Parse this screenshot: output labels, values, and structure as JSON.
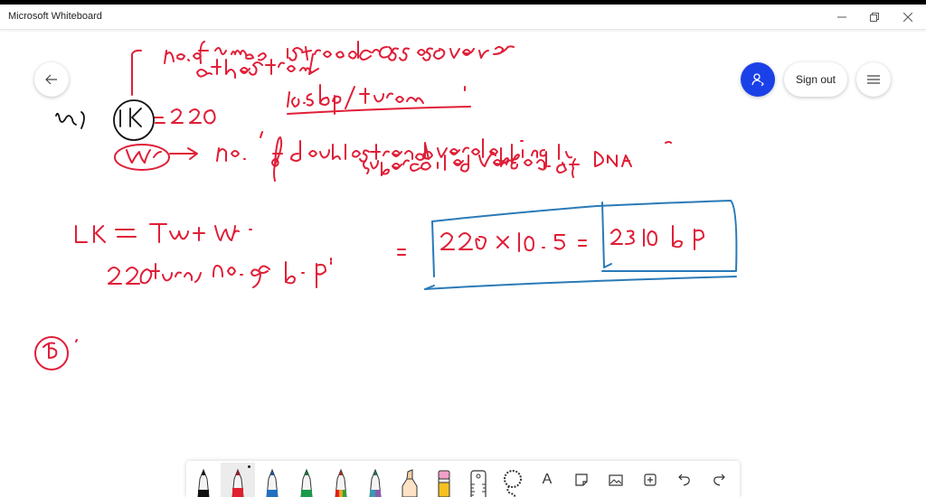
{
  "window": {
    "title": "Microsoft Whiteboard",
    "controls": [
      "minimize",
      "restore",
      "close"
    ]
  },
  "header": {
    "back_icon": "arrow-left-icon",
    "invite_icon": "add-person-icon",
    "invite_color": "#1a40e8",
    "signout_label": "Sign out",
    "menu_icon": "hamburger-icon"
  },
  "ink": {
    "color_red": "#e01e37",
    "color_black": "#111111",
    "color_blue": "#2a7ab8",
    "lines": [
      "no. of times strand crosses over",
      "other strand",
      "a)  (LK) = 220  ;  10.5 bp/turn",
      "(Wr) → no. of double strand overlapping in",
      "supercoiled version of DNA -",
      "LK = Tw + Wr",
      "220 turn; no. of b.p = 220 × 10.5 = 2310 bp",
      "(b)"
    ]
  },
  "toolbar": {
    "tools": [
      {
        "name": "black-pen",
        "color": "#111111",
        "selected": false
      },
      {
        "name": "red-pen",
        "color": "#e0202e",
        "selected": true
      },
      {
        "name": "blue-pen",
        "color": "#2070c0",
        "selected": false
      },
      {
        "name": "green-pen",
        "color": "#1a9a4a",
        "selected": false
      },
      {
        "name": "rainbow-pen",
        "color": "#e06020",
        "selected": false
      },
      {
        "name": "galaxy-pen",
        "color": "#6a6ab0",
        "selected": false
      },
      {
        "name": "highlighter",
        "color": "#f7d0a8",
        "selected": false
      },
      {
        "name": "eraser",
        "color": "#f0a0c8",
        "selected": false
      },
      {
        "name": "ruler",
        "color": "#444444",
        "selected": false
      },
      {
        "name": "lasso",
        "color": "#444444",
        "selected": false
      }
    ],
    "actions": [
      {
        "name": "text",
        "glyph": "A"
      },
      {
        "name": "sticky-note",
        "glyph": "note"
      },
      {
        "name": "image",
        "glyph": "image"
      },
      {
        "name": "insert",
        "glyph": "+"
      },
      {
        "name": "undo",
        "glyph": "↶"
      },
      {
        "name": "redo",
        "glyph": "↷"
      }
    ]
  }
}
